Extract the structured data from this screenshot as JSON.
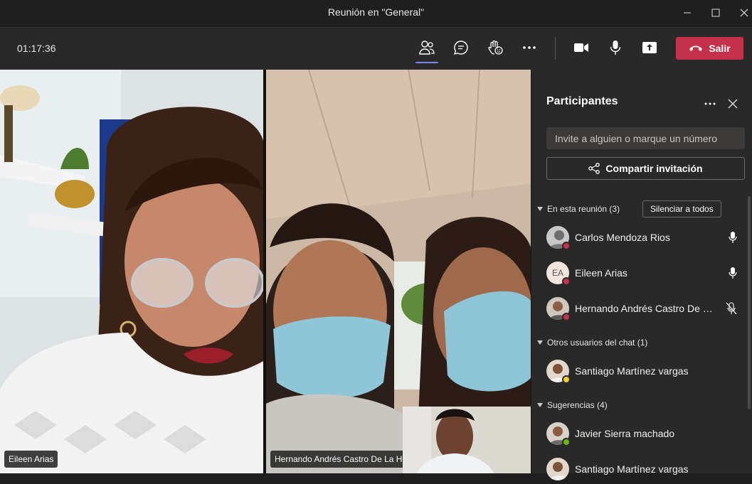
{
  "window": {
    "title": "Reunión en \"General\""
  },
  "toolbar": {
    "timer": "01:17:36",
    "leave_label": "Salir"
  },
  "colors": {
    "accent": "#7f85f5",
    "leave": "#c4314b",
    "busy": "#c4314b",
    "available": "#6bb700",
    "away": "#f8d22a"
  },
  "video": {
    "tile1_name": "Eileen Arias",
    "tile2_name": "Hernando Andrés Castro De La Ho"
  },
  "panel": {
    "title": "Participantes",
    "invite_placeholder": "Invite a alguien o marque un número",
    "share_label": "Compartir invitación",
    "in_meeting_label": "En esta reunión (3)",
    "mute_all_label": "Silenciar a todos",
    "others_label": "Otros usuarios del chat (1)",
    "suggestions_label": "Sugerencias (4)",
    "in_meeting": [
      {
        "name": "Carlos Mendoza Rios",
        "mic": "mic-icon",
        "avatar": "photo"
      },
      {
        "name": "Eileen Arias",
        "initials": "EA",
        "mic": "mic-icon"
      },
      {
        "name": "Hernando Andrés Castro De L...",
        "mic": "mic-off-icon",
        "avatar": "photo"
      }
    ],
    "others": [
      {
        "name": "Santiago Martínez vargas",
        "avatar": "photo"
      }
    ],
    "suggestions": [
      {
        "name": "Javier Sierra machado",
        "avatar": "photo"
      },
      {
        "name": "Santiago Martínez vargas",
        "avatar": "photo"
      }
    ]
  }
}
